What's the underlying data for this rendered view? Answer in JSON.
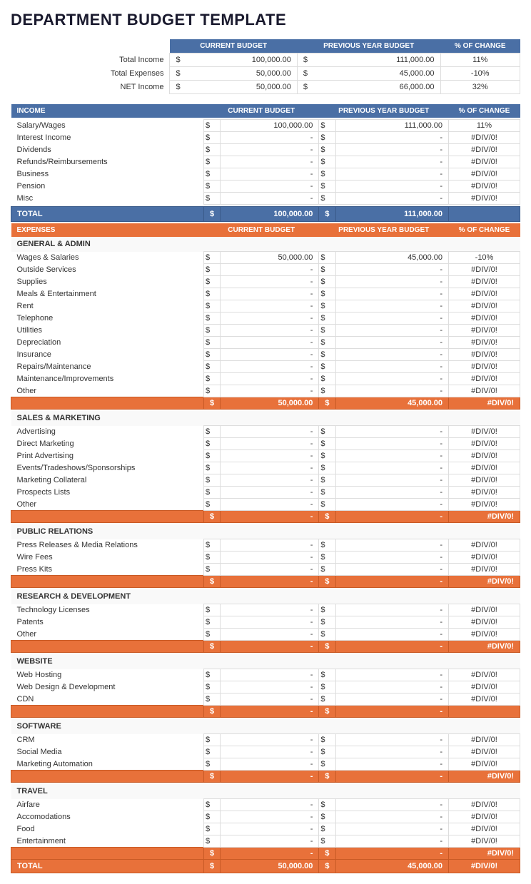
{
  "title": "DEPARTMENT BUDGET TEMPLATE",
  "summary": {
    "headers": [
      "",
      "CURRENT BUDGET",
      "PREVIOUS YEAR BUDGET",
      "% OF CHANGE"
    ],
    "rows": [
      {
        "label": "Total Income",
        "current": "100,000.00",
        "previous": "111,000.00",
        "change": "11%"
      },
      {
        "label": "Total Expenses",
        "current": "50,000.00",
        "previous": "45,000.00",
        "change": "-10%"
      },
      {
        "label": "NET Income",
        "current": "50,000.00",
        "previous": "66,000.00",
        "change": "32%"
      }
    ]
  },
  "income": {
    "section_label": "INCOME",
    "headers": [
      "CURRENT BUDGET",
      "PREVIOUS YEAR BUDGET",
      "% OF CHANGE"
    ],
    "rows": [
      {
        "label": "Salary/Wages",
        "current": "100,000.00",
        "previous": "111,000.00",
        "change": "11%"
      },
      {
        "label": "Interest Income",
        "current": "-",
        "previous": "-",
        "change": "#DIV/0!"
      },
      {
        "label": "Dividends",
        "current": "-",
        "previous": "-",
        "change": "#DIV/0!"
      },
      {
        "label": "Refunds/Reimbursements",
        "current": "-",
        "previous": "-",
        "change": "#DIV/0!"
      },
      {
        "label": "Business",
        "current": "-",
        "previous": "-",
        "change": "#DIV/0!"
      },
      {
        "label": "Pension",
        "current": "-",
        "previous": "-",
        "change": "#DIV/0!"
      },
      {
        "label": "Misc",
        "current": "-",
        "previous": "-",
        "change": "#DIV/0!"
      }
    ],
    "total_label": "TOTAL",
    "total_current": "100,000.00",
    "total_previous": "111,000.00"
  },
  "expenses": {
    "section_label": "EXPENSES",
    "headers": [
      "CURRENT BUDGET",
      "PREVIOUS YEAR BUDGET",
      "% OF CHANGE"
    ],
    "subsections": [
      {
        "title": "GENERAL & ADMIN",
        "rows": [
          {
            "label": "Wages & Salaries",
            "current": "50,000.00",
            "previous": "45,000.00",
            "change": "-10%"
          },
          {
            "label": "Outside Services",
            "current": "-",
            "previous": "-",
            "change": "#DIV/0!"
          },
          {
            "label": "Supplies",
            "current": "-",
            "previous": "-",
            "change": "#DIV/0!"
          },
          {
            "label": "Meals & Entertainment",
            "current": "-",
            "previous": "-",
            "change": "#DIV/0!"
          },
          {
            "label": "Rent",
            "current": "-",
            "previous": "-",
            "change": "#DIV/0!"
          },
          {
            "label": "Telephone",
            "current": "-",
            "previous": "-",
            "change": "#DIV/0!"
          },
          {
            "label": "Utilities",
            "current": "-",
            "previous": "-",
            "change": "#DIV/0!"
          },
          {
            "label": "Depreciation",
            "current": "-",
            "previous": "-",
            "change": "#DIV/0!"
          },
          {
            "label": "Insurance",
            "current": "-",
            "previous": "-",
            "change": "#DIV/0!"
          },
          {
            "label": "Repairs/Maintenance",
            "current": "-",
            "previous": "-",
            "change": "#DIV/0!"
          },
          {
            "label": "Maintenance/Improvements",
            "current": "-",
            "previous": "-",
            "change": "#DIV/0!"
          },
          {
            "label": "Other",
            "current": "-",
            "previous": "-",
            "change": "#DIV/0!"
          }
        ],
        "subtotal_current": "50,000.00",
        "subtotal_previous": "45,000.00",
        "subtotal_change": "#DIV/0!"
      },
      {
        "title": "SALES & MARKETING",
        "rows": [
          {
            "label": "Advertising",
            "current": "-",
            "previous": "-",
            "change": "#DIV/0!"
          },
          {
            "label": "Direct Marketing",
            "current": "-",
            "previous": "-",
            "change": "#DIV/0!"
          },
          {
            "label": "Print Advertising",
            "current": "-",
            "previous": "-",
            "change": "#DIV/0!"
          },
          {
            "label": "Events/Tradeshows/Sponsorships",
            "current": "-",
            "previous": "-",
            "change": "#DIV/0!"
          },
          {
            "label": "Marketing Collateral",
            "current": "-",
            "previous": "-",
            "change": "#DIV/0!"
          },
          {
            "label": "Prospects Lists",
            "current": "-",
            "previous": "-",
            "change": "#DIV/0!"
          },
          {
            "label": "Other",
            "current": "-",
            "previous": "-",
            "change": "#DIV/0!"
          }
        ],
        "subtotal_current": "-",
        "subtotal_previous": "-",
        "subtotal_change": "#DIV/0!"
      },
      {
        "title": "PUBLIC RELATIONS",
        "rows": [
          {
            "label": "Press Releases & Media Relations",
            "current": "-",
            "previous": "-",
            "change": "#DIV/0!"
          },
          {
            "label": "Wire Fees",
            "current": "-",
            "previous": "-",
            "change": "#DIV/0!"
          },
          {
            "label": "Press Kits",
            "current": "-",
            "previous": "-",
            "change": "#DIV/0!"
          }
        ],
        "subtotal_current": "-",
        "subtotal_previous": "-",
        "subtotal_change": "#DIV/0!"
      },
      {
        "title": "RESEARCH & DEVELOPMENT",
        "rows": [
          {
            "label": "Technology Licenses",
            "current": "-",
            "previous": "-",
            "change": "#DIV/0!"
          },
          {
            "label": "Patents",
            "current": "-",
            "previous": "-",
            "change": "#DIV/0!"
          },
          {
            "label": "Other",
            "current": "-",
            "previous": "-",
            "change": "#DIV/0!"
          }
        ],
        "subtotal_current": "-",
        "subtotal_previous": "-",
        "subtotal_change": "#DIV/0!"
      },
      {
        "title": "WEBSITE",
        "rows": [
          {
            "label": "Web Hosting",
            "current": "-",
            "previous": "-",
            "change": "#DIV/0!"
          },
          {
            "label": "Web Design & Development",
            "current": "-",
            "previous": "-",
            "change": "#DIV/0!"
          },
          {
            "label": "CDN",
            "current": "-",
            "previous": "-",
            "change": "#DIV/0!"
          }
        ],
        "subtotal_current": "-",
        "subtotal_previous": "-",
        "subtotal_change": ""
      },
      {
        "title": "SOFTWARE",
        "rows": [
          {
            "label": "CRM",
            "current": "-",
            "previous": "-",
            "change": "#DIV/0!"
          },
          {
            "label": "Social Media",
            "current": "-",
            "previous": "-",
            "change": "#DIV/0!"
          },
          {
            "label": "Marketing Automation",
            "current": "-",
            "previous": "-",
            "change": "#DIV/0!"
          }
        ],
        "subtotal_current": "-",
        "subtotal_previous": "-",
        "subtotal_change": "#DIV/0!"
      },
      {
        "title": "TRAVEL",
        "rows": [
          {
            "label": "Airfare",
            "current": "-",
            "previous": "-",
            "change": "#DIV/0!"
          },
          {
            "label": "Accomodations",
            "current": "-",
            "previous": "-",
            "change": "#DIV/0!"
          },
          {
            "label": "Food",
            "current": "-",
            "previous": "-",
            "change": "#DIV/0!"
          },
          {
            "label": "Entertainment",
            "current": "-",
            "previous": "-",
            "change": "#DIV/0!"
          }
        ],
        "subtotal_current": "-",
        "subtotal_previous": "-",
        "subtotal_change": "#DIV/0!"
      }
    ],
    "total_label": "TOTAL",
    "total_current": "50,000.00",
    "total_previous": "45,000.00",
    "total_change": "#DIV/0!"
  }
}
